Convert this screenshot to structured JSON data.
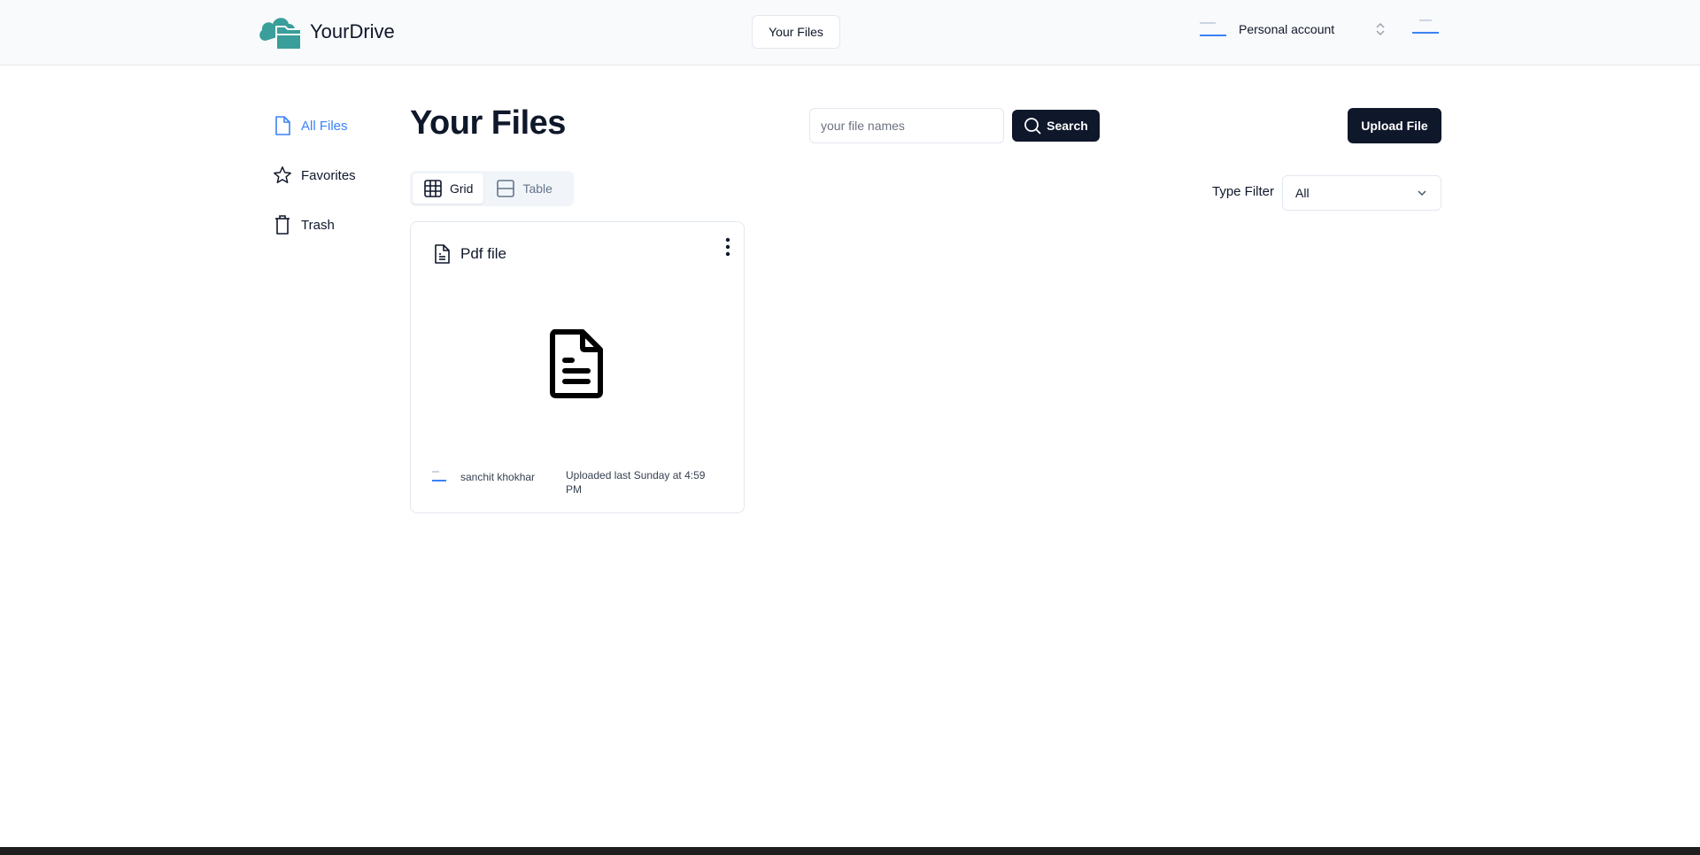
{
  "header": {
    "brand_name": "YourDrive",
    "nav_label": "Your Files",
    "account_label": "Personal account"
  },
  "sidebar": {
    "items": [
      {
        "label": "All Files",
        "icon": "file-icon",
        "active": true
      },
      {
        "label": "Favorites",
        "icon": "star-icon",
        "active": false
      },
      {
        "label": "Trash",
        "icon": "trash-icon",
        "active": false
      }
    ]
  },
  "main": {
    "title": "Your Files",
    "search": {
      "placeholder": "your file names",
      "value": "",
      "button_label": "Search"
    },
    "upload_label": "Upload File",
    "view_tabs": [
      {
        "label": "Grid",
        "icon": "grid-icon",
        "active": true
      },
      {
        "label": "Table",
        "icon": "table-icon",
        "active": false
      }
    ],
    "filter": {
      "label": "Type Filter",
      "selected": "All"
    },
    "files": [
      {
        "name": "Pdf file",
        "owner": "sanchit khokhar",
        "uploaded": "Uploaded last Sunday at 4:59 PM",
        "type_icon": "file-text-icon"
      }
    ]
  },
  "colors": {
    "accent": "#3b82f6",
    "brand": "#3a9e9a",
    "dark_button": "#0f172a"
  }
}
